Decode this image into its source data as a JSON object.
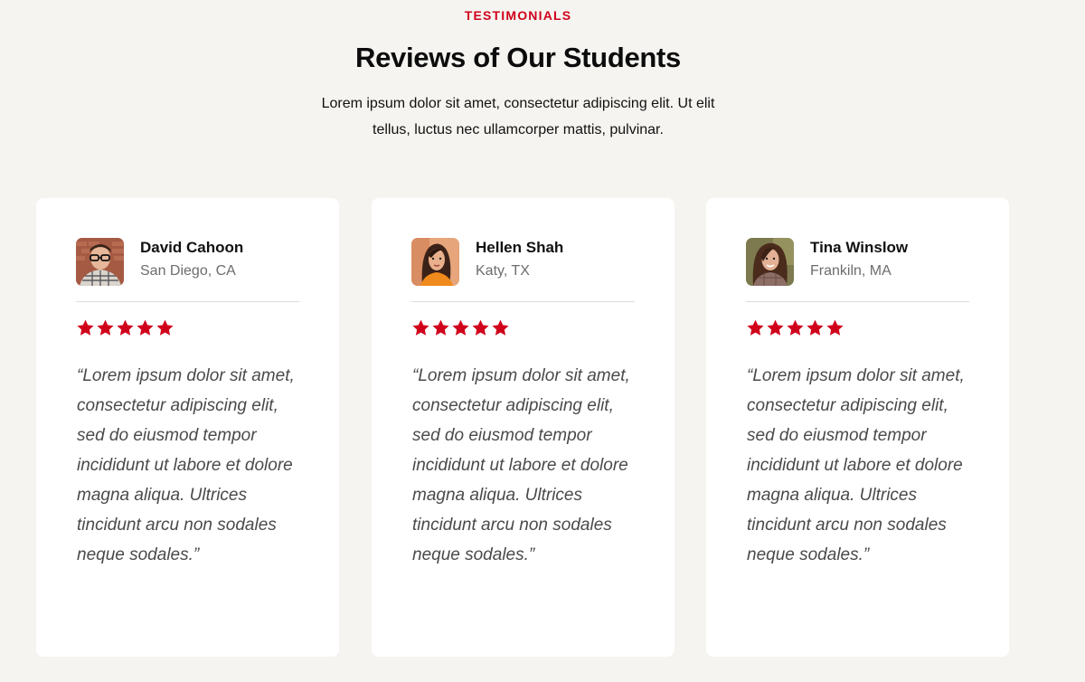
{
  "section": {
    "eyebrow": "TESTIMONIALS",
    "title": "Reviews of Our Students",
    "intro": "Lorem ipsum dolor sit amet, consectetur adipiscing elit. Ut elit tellus, luctus nec ullamcorper mattis, pulvinar."
  },
  "colors": {
    "accent": "#d0021b",
    "background": "#f5f4f0",
    "card": "#ffffff"
  },
  "testimonials": [
    {
      "name": "David Cahoon",
      "location": "San Diego, CA",
      "rating": 5,
      "quote": "“Lorem ipsum dolor sit amet, consectetur adipiscing elit, sed do eiusmod tempor incididunt ut labore et dolore magna aliqua. Ultrices tincidunt arcu non sodales neque sodales.”"
    },
    {
      "name": "Hellen Shah",
      "location": "Katy, TX",
      "rating": 5,
      "quote": "“Lorem ipsum dolor sit amet, consectetur adipiscing elit, sed do eiusmod tempor incididunt ut labore et dolore magna aliqua. Ultrices tincidunt arcu non sodales neque sodales.”"
    },
    {
      "name": "Tina Winslow",
      "location": "Frankiln, MA",
      "rating": 5,
      "quote": "“Lorem ipsum dolor sit amet, consectetur adipiscing elit, sed do eiusmod tempor incididunt ut labore et dolore magna aliqua. Ultrices tincidunt arcu non sodales neque sodales.”"
    }
  ]
}
